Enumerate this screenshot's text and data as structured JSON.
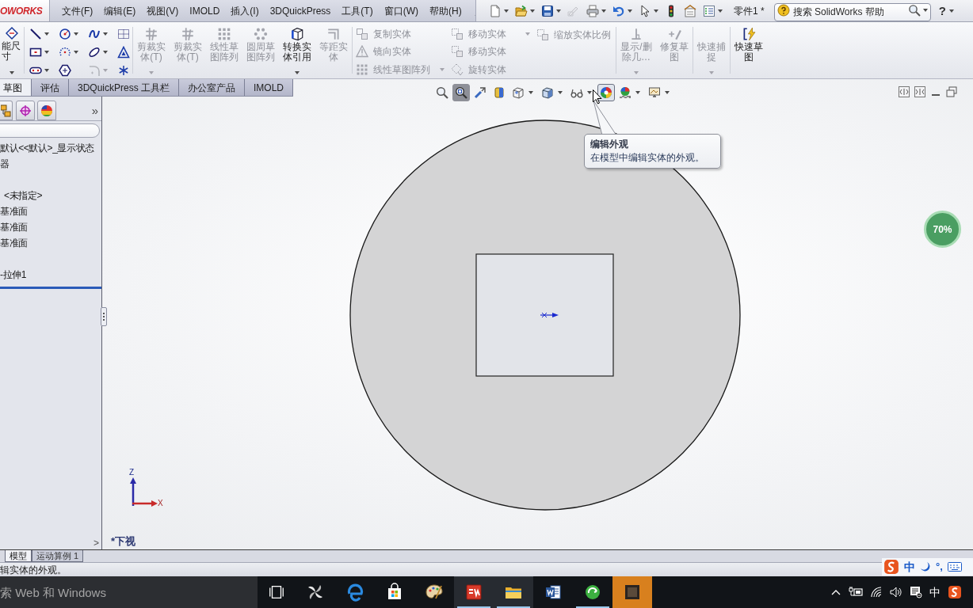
{
  "title_bar": {
    "logo": "OWORKS",
    "menus": [
      "文件(F)",
      "编辑(E)",
      "视图(V)",
      "IMOLD",
      "插入(I)",
      "3DQuickPress",
      "工具(T)",
      "窗口(W)",
      "帮助(H)"
    ],
    "standard_toolbar": [
      {
        "disabled": false,
        "dropdown": true
      },
      {
        "disabled": false,
        "dropdown": true
      },
      {
        "disabled": false,
        "dropdown": true
      },
      {
        "disabled": true,
        "dropdown": false
      },
      {
        "disabled": false,
        "dropdown": true
      },
      {
        "disabled": false,
        "dropdown": true
      },
      {
        "disabled": false,
        "dropdown": true
      },
      {
        "disabled": false,
        "dropdown": false
      },
      {
        "disabled": false,
        "dropdown": false
      },
      {
        "disabled": false,
        "dropdown": true
      }
    ],
    "document_title": "零件1 *",
    "search": {
      "placeholder": "搜索 SolidWorks 帮助"
    },
    "help": "?"
  },
  "command_manager": {
    "smart_dimension": {
      "label": "能尺寸",
      "dropdown": true
    },
    "sketch_tools": [
      {
        "disabled": false,
        "dropdown": true
      },
      {
        "disabled": false,
        "dropdown": true
      },
      {
        "disabled": false,
        "dropdown": true
      },
      {
        "disabled": false,
        "dropdown": false
      },
      {
        "disabled": false,
        "dropdown": true
      },
      {
        "disabled": false,
        "dropdown": true
      },
      {
        "disabled": false,
        "dropdown": true
      },
      {
        "disabled": false,
        "dropdown": false
      },
      {
        "disabled": false,
        "dropdown": true
      },
      {
        "disabled": false,
        "dropdown": false
      },
      {
        "disabled": true,
        "dropdown": true
      },
      {
        "disabled": false,
        "dropdown": false
      }
    ],
    "large_commands": [
      {
        "label": "剪裁实体(T)",
        "disabled": true,
        "dropdown": true
      },
      {
        "label": "剪裁实体(T)",
        "disabled": true,
        "dropdown": false
      },
      {
        "label": "线性草图阵列",
        "disabled": true,
        "dropdown": false
      },
      {
        "label": "圆周草图阵列",
        "disabled": true,
        "dropdown": false
      },
      {
        "label": "转换实体引用",
        "disabled": false,
        "dropdown": true
      },
      {
        "label": "等距实体",
        "disabled": true,
        "dropdown": false
      }
    ],
    "list_columns": [
      [
        {
          "label": "复制实体",
          "disabled": true,
          "dropdown": false
        },
        {
          "label": "镜向实体",
          "disabled": true,
          "dropdown": false
        },
        {
          "label": "线性草图阵列",
          "disabled": true,
          "dropdown": true
        }
      ],
      [
        {
          "label": "移动实体",
          "disabled": true,
          "dropdown": true
        },
        {
          "label": "移动实体",
          "disabled": true,
          "dropdown": false
        },
        {
          "label": "旋转实体",
          "disabled": true,
          "dropdown": false
        }
      ],
      [
        {
          "label": "缩放实体比例",
          "disabled": true,
          "dropdown": false
        }
      ]
    ],
    "relation_commands": [
      {
        "label": "显示/删除几…",
        "disabled": true,
        "dropdown": true
      },
      {
        "label": "修复草图",
        "disabled": true,
        "dropdown": false
      },
      {
        "label": "快速捕捉",
        "disabled": true,
        "dropdown": true
      },
      {
        "label": "快速草图",
        "disabled": false,
        "dropdown": false
      }
    ],
    "tabs": [
      {
        "label": "草图",
        "selected": true
      },
      {
        "label": "评估",
        "selected": false
      },
      {
        "label": "3DQuickPress 工具栏",
        "selected": false
      },
      {
        "label": "办公室产品",
        "selected": false
      },
      {
        "label": "IMOLD",
        "selected": false
      }
    ]
  },
  "feature_manager": {
    "more": "»",
    "tree": [
      {
        "label": "默认<<默认>_显示状态"
      },
      {
        "label": "器"
      },
      {
        "label": "<未指定>"
      },
      {
        "label": "基准面"
      },
      {
        "label": "基准面"
      },
      {
        "label": "基准面"
      },
      {
        "label": "-拉伸1"
      }
    ],
    "flyout": ">"
  },
  "graphics": {
    "view_toolbar": [
      {
        "pressed": false,
        "hovered": false,
        "dropdown": false
      },
      {
        "pressed": true,
        "hovered": false,
        "dropdown": false
      },
      {
        "pressed": false,
        "hovered": false,
        "dropdown": false
      },
      {
        "pressed": false,
        "hovered": false,
        "dropdown": false
      },
      {
        "pressed": false,
        "hovered": false,
        "dropdown": true
      },
      {
        "pressed": false,
        "hovered": false,
        "dropdown": true
      },
      {
        "pressed": false,
        "hovered": false,
        "dropdown": true
      },
      {
        "pressed": false,
        "hovered": true,
        "dropdown": false
      },
      {
        "pressed": false,
        "hovered": false,
        "dropdown": true
      },
      {
        "pressed": false,
        "hovered": false,
        "dropdown": true
      }
    ],
    "tooltip": {
      "title": "编辑外观",
      "text": "在模型中编辑实体的外观。"
    },
    "triad": {
      "z": "Z",
      "x": "X"
    },
    "view_name": "*下视",
    "floating_widget": {
      "text": "70%"
    }
  },
  "model_tabs": [
    {
      "label": "模型",
      "selected": true
    },
    {
      "label": "运动算例 1",
      "selected": false
    }
  ],
  "status_bar": {
    "message": "辑实体的外观。"
  },
  "ime_bar": {
    "mode": "中",
    "punctuation": "°,"
  },
  "taskbar": {
    "search": {
      "placeholder": "索 Web 和 Windows"
    },
    "apps": [
      {
        "running": false,
        "active": false,
        "attention": false
      },
      {
        "running": false,
        "active": false,
        "attention": false
      },
      {
        "running": false,
        "active": false,
        "attention": false
      },
      {
        "running": false,
        "active": false,
        "attention": false
      },
      {
        "running": true,
        "active": true,
        "attention": false
      },
      {
        "running": true,
        "active": true,
        "attention": false
      },
      {
        "running": false,
        "active": false,
        "attention": false
      },
      {
        "running": true,
        "active": false,
        "attention": false
      },
      {
        "running": false,
        "active": false,
        "attention": true
      }
    ],
    "language": "中"
  }
}
